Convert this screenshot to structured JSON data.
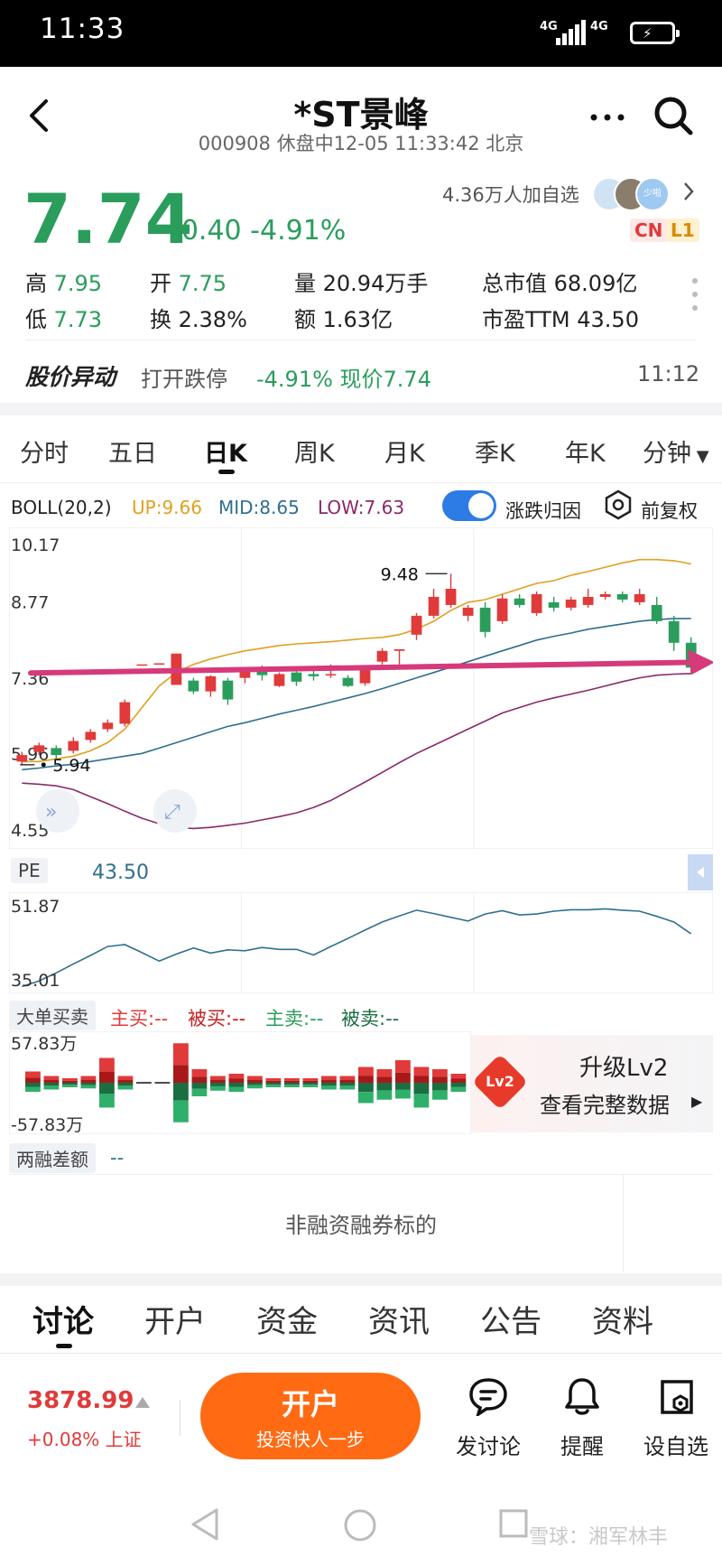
{
  "status_bar": {
    "time": "11:33",
    "signal1": "4G",
    "signal2": "4G"
  },
  "header": {
    "title": "*ST景峰",
    "subtitle": "000908 休盘中12-05 11:33:42 北京"
  },
  "quote": {
    "price": "7.74",
    "change": "-0.40 -4.91%",
    "followers": "4.36万人加自选",
    "badge_cn": "CN",
    "badge_l1": "L1",
    "avatar_badge": "少啦",
    "stats": {
      "high_label": "高",
      "high": "7.95",
      "open_label": "开",
      "open": "7.75",
      "volume_label": "量",
      "volume": "20.94万手",
      "mktcap_label": "总市值",
      "mktcap": "68.09亿",
      "low_label": "低",
      "low": "7.73",
      "turnover_label": "换",
      "turnover": "2.38%",
      "amount_label": "额",
      "amount": "1.63亿",
      "pe_label": "市盈TTM",
      "pe": "43.50"
    }
  },
  "alert": {
    "label": "股价异动",
    "text": "打开跌停",
    "change": "-4.91% 现价7.74",
    "time": "11:12"
  },
  "period_tabs": [
    "分时",
    "五日",
    "日K",
    "周K",
    "月K",
    "季K",
    "年K",
    "分钟"
  ],
  "boll": {
    "label": "BOLL(20,2)",
    "up": "UP:9.66",
    "mid": "MID:8.65",
    "low": "LOW:7.63",
    "toggle_label": "涨跌归因",
    "adjust_label": "前复权"
  },
  "chart_data": [
    {
      "type": "candlestick",
      "title": "日K",
      "y_ticks": [
        "10.17",
        "8.77",
        "7.36",
        "5.96",
        "4.55"
      ],
      "ylim": [
        4.55,
        10.17
      ],
      "annotations": {
        "max": "9.48",
        "min": "5.94"
      },
      "candles": [
        {
          "o": 6.0,
          "c": 6.12,
          "h": 6.18,
          "l": 5.94
        },
        {
          "o": 6.18,
          "c": 6.3,
          "h": 6.35,
          "l": 6.12
        },
        {
          "o": 6.25,
          "c": 6.12,
          "h": 6.3,
          "l": 6.05
        },
        {
          "o": 6.2,
          "c": 6.38,
          "h": 6.45,
          "l": 6.15
        },
        {
          "o": 6.4,
          "c": 6.55,
          "h": 6.6,
          "l": 6.35
        },
        {
          "o": 6.6,
          "c": 6.72,
          "h": 6.78,
          "l": 6.55
        },
        {
          "o": 6.7,
          "c": 7.1,
          "h": 7.15,
          "l": 6.65
        },
        {
          "o": 7.8,
          "c": 7.8,
          "h": 7.8,
          "l": 7.8
        },
        {
          "o": 7.82,
          "c": 7.82,
          "h": 7.82,
          "l": 7.82
        },
        {
          "o": 7.42,
          "c": 8.0,
          "h": 8.0,
          "l": 7.42
        },
        {
          "o": 7.5,
          "c": 7.3,
          "h": 7.55,
          "l": 7.25
        },
        {
          "o": 7.3,
          "c": 7.58,
          "h": 7.6,
          "l": 7.2
        },
        {
          "o": 7.5,
          "c": 7.15,
          "h": 7.55,
          "l": 7.05
        },
        {
          "o": 7.55,
          "c": 7.7,
          "h": 7.75,
          "l": 7.45
        },
        {
          "o": 7.7,
          "c": 7.6,
          "h": 7.78,
          "l": 7.5
        },
        {
          "o": 7.4,
          "c": 7.62,
          "h": 7.65,
          "l": 7.38
        },
        {
          "o": 7.65,
          "c": 7.48,
          "h": 7.7,
          "l": 7.4
        },
        {
          "o": 7.62,
          "c": 7.58,
          "h": 7.68,
          "l": 7.5
        },
        {
          "o": 7.6,
          "c": 7.62,
          "h": 7.8,
          "l": 7.55
        },
        {
          "o": 7.55,
          "c": 7.4,
          "h": 7.6,
          "l": 7.38
        },
        {
          "o": 7.45,
          "c": 7.7,
          "h": 7.72,
          "l": 7.4
        },
        {
          "o": 7.85,
          "c": 8.05,
          "h": 8.1,
          "l": 7.8
        },
        {
          "o": 8.05,
          "c": 8.08,
          "h": 8.08,
          "l": 7.8
        },
        {
          "o": 8.35,
          "c": 8.7,
          "h": 8.75,
          "l": 8.25
        },
        {
          "o": 8.7,
          "c": 9.05,
          "h": 9.2,
          "l": 8.65
        },
        {
          "o": 8.9,
          "c": 9.2,
          "h": 9.48,
          "l": 8.85
        },
        {
          "o": 8.7,
          "c": 8.85,
          "h": 8.9,
          "l": 8.6
        },
        {
          "o": 8.85,
          "c": 8.4,
          "h": 8.95,
          "l": 8.3
        },
        {
          "o": 8.6,
          "c": 9.02,
          "h": 9.1,
          "l": 8.55
        },
        {
          "o": 9.02,
          "c": 8.9,
          "h": 9.1,
          "l": 8.85
        },
        {
          "o": 8.75,
          "c": 9.1,
          "h": 9.15,
          "l": 8.7
        },
        {
          "o": 8.95,
          "c": 8.85,
          "h": 9.05,
          "l": 8.78
        },
        {
          "o": 8.85,
          "c": 9.0,
          "h": 9.05,
          "l": 8.8
        },
        {
          "o": 8.9,
          "c": 9.05,
          "h": 9.2,
          "l": 8.85
        },
        {
          "o": 9.05,
          "c": 9.1,
          "h": 9.15,
          "l": 9.0
        },
        {
          "o": 9.1,
          "c": 9.0,
          "h": 9.15,
          "l": 8.95
        },
        {
          "o": 8.95,
          "c": 9.1,
          "h": 9.2,
          "l": 8.9
        },
        {
          "o": 8.9,
          "c": 8.6,
          "h": 9.05,
          "l": 8.55
        },
        {
          "o": 8.6,
          "c": 8.2,
          "h": 8.7,
          "l": 8.05
        },
        {
          "o": 8.2,
          "c": 7.74,
          "h": 8.3,
          "l": 7.62
        }
      ],
      "series": [
        {
          "name": "UP",
          "color": "#e0a020",
          "values": [
            6.0,
            6.0,
            6.05,
            6.1,
            6.2,
            6.35,
            6.6,
            7.0,
            7.4,
            7.65,
            7.8,
            7.9,
            7.98,
            8.05,
            8.1,
            8.15,
            8.18,
            8.2,
            8.22,
            8.25,
            8.28,
            8.3,
            8.35,
            8.45,
            8.6,
            8.8,
            8.95,
            9.0,
            9.1,
            9.2,
            9.3,
            9.35,
            9.45,
            9.52,
            9.6,
            9.68,
            9.74,
            9.74,
            9.72,
            9.66
          ]
        },
        {
          "name": "MID",
          "color": "#2f6f8f",
          "values": [
            5.85,
            5.88,
            5.92,
            5.95,
            6.0,
            6.05,
            6.1,
            6.15,
            6.25,
            6.35,
            6.45,
            6.55,
            6.65,
            6.72,
            6.8,
            6.88,
            6.95,
            7.02,
            7.1,
            7.18,
            7.26,
            7.35,
            7.45,
            7.55,
            7.65,
            7.75,
            7.85,
            7.95,
            8.05,
            8.15,
            8.25,
            8.32,
            8.38,
            8.45,
            8.5,
            8.55,
            8.6,
            8.63,
            8.65,
            8.65
          ]
        },
        {
          "name": "LOW",
          "color": "#8a2a6a",
          "values": [
            5.6,
            5.58,
            5.55,
            5.48,
            5.35,
            5.22,
            5.08,
            4.95,
            4.85,
            4.78,
            4.76,
            4.78,
            4.82,
            4.86,
            4.92,
            4.98,
            5.05,
            5.15,
            5.28,
            5.45,
            5.62,
            5.8,
            5.98,
            6.15,
            6.3,
            6.45,
            6.6,
            6.75,
            6.9,
            7.0,
            7.1,
            7.18,
            7.25,
            7.32,
            7.4,
            7.48,
            7.55,
            7.6,
            7.62,
            7.63
          ]
        }
      ]
    },
    {
      "type": "line",
      "title": "PE",
      "value_label": "43.50",
      "y_ticks": [
        "51.87",
        "35.01"
      ],
      "ylim": [
        35.01,
        51.87
      ],
      "series": [
        {
          "color": "#2f6f8f",
          "values": [
            35.3,
            36.5,
            38.2,
            40.1,
            41.9,
            43.8,
            44.2,
            42.5,
            40.7,
            42.2,
            43.5,
            42.4,
            43.1,
            42.9,
            43.6,
            43.2,
            43.2,
            42.0,
            43.8,
            45.5,
            47.3,
            49.0,
            50.3,
            51.5,
            50.8,
            50.0,
            49.2,
            50.7,
            51.4,
            50.5,
            50.7,
            51.3,
            51.6,
            51.6,
            51.8,
            51.5,
            51.3,
            50.2,
            49.0,
            46.5
          ]
        }
      ]
    },
    {
      "type": "bar",
      "title": "大单买卖",
      "legend": [
        "主买:--",
        "被买:--",
        "主卖:--",
        "被卖:--"
      ],
      "y_ticks": [
        "57.83万",
        "-57.83万"
      ],
      "ylim": [
        -57.83,
        57.83
      ],
      "buy": [
        10,
        6,
        4,
        6,
        22,
        6,
        0,
        0,
        35,
        12,
        6,
        8,
        6,
        4,
        4,
        4,
        6,
        6,
        14,
        12,
        20,
        14,
        12,
        8
      ],
      "sell": [
        -8,
        -6,
        -4,
        -5,
        -22,
        -6,
        -1,
        -1,
        -35,
        -12,
        -7,
        -8,
        -5,
        -4,
        -4,
        -4,
        -6,
        -6,
        -18,
        -15,
        -14,
        -22,
        -15,
        -8
      ]
    }
  ],
  "pe_panel": {
    "label": "PE",
    "value": "43.50",
    "y_max": "51.87",
    "y_min": "35.01"
  },
  "bigorder_panel": {
    "label": "大单买卖",
    "main_buy": "主买:--",
    "passive_buy": "被买:--",
    "main_sell": "主卖:--",
    "passive_sell": "被卖:--",
    "y_max": "57.83万",
    "y_min": "-57.83万",
    "upgrade_badge": "Lv2",
    "upgrade_title": "升级Lv2",
    "upgrade_sub": "查看完整数据"
  },
  "margin_panel": {
    "label": "两融差额",
    "value": "--",
    "note": "非融资融券标的"
  },
  "bottom_tabs": [
    "讨论",
    "开户",
    "资金",
    "资讯",
    "公告",
    "资料"
  ],
  "footer": {
    "index_value": "3878.99",
    "index_change": "+0.08% 上证",
    "cta_title": "开户",
    "cta_sub": "投资快人一步",
    "discuss": "发讨论",
    "remind": "提醒",
    "watchlist": "设自选"
  },
  "watermark": "雪球：湘军林丰",
  "colors": {
    "up": "#e03a3a",
    "down": "#2a9d5c",
    "accent": "#ff6a13",
    "boll_up": "#e0a020",
    "boll_mid": "#2f6f8f",
    "boll_low": "#8a2a6a",
    "arrow": "#d63a7a"
  }
}
